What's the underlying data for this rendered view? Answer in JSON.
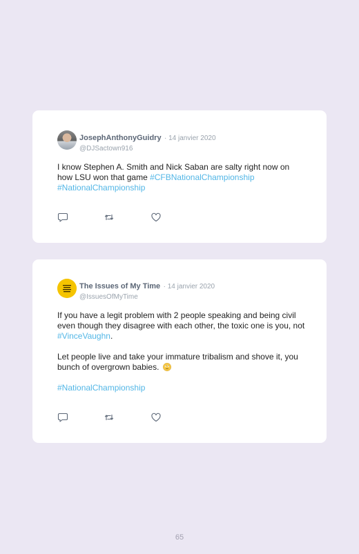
{
  "tweets": [
    {
      "name": "JosephAnthonyGuidry",
      "date": "· 14 janvier 2020",
      "handle": "@DJSactown916",
      "body_text": "I know Stephen A. Smith and Nick Saban are salty right now on how LSU won that game ",
      "hashtag1": "#CFBNationalChampionship",
      "hashtag2": "#NationalChampionship",
      "avatar_icon": "profile-photo"
    },
    {
      "name": "The Issues of My Time",
      "date": "· 14 janvier 2020",
      "handle": "@IssuesOfMyTime",
      "para1_text": "If you have a legit problem with 2 people speaking and being civil even though they disagree with each other, the toxic one is you, not ",
      "para1_hashtag": "#VinceVaughn",
      "para1_end": ".",
      "para2_text": "Let people live and take your immature tribalism and shove it, you bunch of overgrown babies. ",
      "para2_emoji": "eye-roll-emoji",
      "hashtag": "#NationalChampionship",
      "avatar_logo_text": "THE ISSUES OF MY TIME",
      "avatar_color": "#f5c400"
    }
  ],
  "page_number": "65",
  "colors": {
    "background": "#ebe7f3",
    "card": "#ffffff",
    "hashtag": "#52b6e6",
    "name": "#5b6676",
    "muted": "#9aa3ad"
  },
  "action_icons": [
    "reply-icon",
    "retweet-icon",
    "like-icon"
  ]
}
